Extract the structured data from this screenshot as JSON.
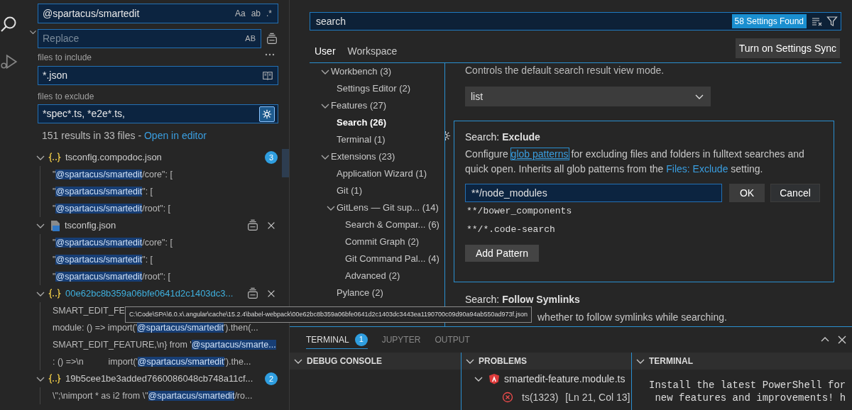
{
  "activity_bar": {
    "items": [
      {
        "kind": "search",
        "selected": true
      },
      {
        "kind": "run_debug",
        "selected": false
      }
    ]
  },
  "search_panel": {
    "replace_expanded": true,
    "query": "@spartacus/smartedit",
    "query_options": [
      "Aa",
      "ab",
      ".*"
    ],
    "replace_placeholder": "Replace",
    "replace_option": "AB",
    "include_label": "files to include",
    "include_value": "*.json",
    "exclude_label": "files to exclude",
    "exclude_value": "*spec*.ts, *e2e*.ts,",
    "use_exclude_settings": true,
    "summary": "151 results in 33 files - ",
    "open_in_editor": "Open in editor",
    "results": [
      {
        "name": "tsconfig.compodoc.json",
        "kind": "json",
        "focused": false,
        "expanded": true,
        "badge": "3",
        "matches": [
          {
            "before": "\"",
            "match": "@spartacus/smartedit",
            "after": "/core\": ["
          },
          {
            "before": "\"",
            "match": "@spartacus/smartedit",
            "after": "\": ["
          },
          {
            "before": "\"",
            "match": "@spartacus/smartedit",
            "after": "/root\": ["
          }
        ]
      },
      {
        "name": "tsconfig.json",
        "kind": "ts",
        "focused": false,
        "expanded": true,
        "matches": [
          {
            "before": "\"",
            "match": "@spartacus/smartedit",
            "after": "/core\": ["
          },
          {
            "before": "\"",
            "match": "@spartacus/smartedit",
            "after": "\": ["
          },
          {
            "before": "\"",
            "match": "@spartacus/smartedit",
            "after": "/root\": ["
          }
        ]
      },
      {
        "name": "00e62bc8b359a06bfe0641d2c1403dc3...",
        "kind": "json",
        "focused": true,
        "expanded": true,
        "matches": [
          {
            "before": "SMART_EDIT_FE"
          },
          {
            "before": "module: () => import('",
            "match": "@spartacus/smartedit",
            "after": "').then(..."
          },
          {
            "before": "SMART_EDIT_FEATURE,\\n} from '",
            "match": "@spartacus/smarte..."
          },
          {
            "before": ": () =>\\n          import('",
            "match": "@spartacus/smartedit",
            "after": "').the..."
          }
        ]
      },
      {
        "name": "19b5cee1be3added7660086048cb748a11cf...",
        "kind": "json",
        "focused": false,
        "expanded": true,
        "badge": "2",
        "matches": [
          {
            "before": "\\\";\\nimport * as i2 from \\\"",
            "match": "@spartacus/smartedit",
            "after": "/ro..."
          }
        ]
      }
    ]
  },
  "settings": {
    "search": "search",
    "found": "58 Settings Found",
    "tabs": [
      {
        "label": "User",
        "selected": true
      },
      {
        "label": "Workspace",
        "selected": false
      }
    ],
    "sync_button": "Turn on Settings Sync",
    "toc": [
      {
        "label": "Workbench (3)",
        "expanded": true,
        "selected": false,
        "children": [
          {
            "label": "Settings Editor (2)",
            "selected": false
          }
        ]
      },
      {
        "label": "Features (27)",
        "expanded": true,
        "selected": false,
        "children": [
          {
            "label": "Search (26)",
            "selected": true
          },
          {
            "label": "Terminal (1)",
            "selected": false
          }
        ]
      },
      {
        "label": "Extensions (23)",
        "expanded": true,
        "selected": false,
        "children": [
          {
            "label": "Application Wizard (1)",
            "selected": false
          },
          {
            "label": "Git (1)",
            "selected": false
          },
          {
            "label": "GitLens — Git sup... (14)",
            "expanded": true,
            "selected": false,
            "children": [
              {
                "label": "Search & Compar... (6)",
                "selected": false
              },
              {
                "label": "Commit Graph (2)",
                "selected": false
              },
              {
                "label": "Git Command Pal... (4)",
                "selected": false
              },
              {
                "label": "Advanced (2)",
                "selected": false
              }
            ]
          },
          {
            "label": "Pylance (2)",
            "selected": false
          }
        ]
      }
    ],
    "sections": [
      {
        "kind": "dropdown",
        "description": "Controls the default search result view mode.",
        "value": "list"
      },
      {
        "kind": "list_editor",
        "focused": true,
        "category": "Search: ",
        "title": "Exclude",
        "description": [
          {
            "text": "Configure "
          },
          {
            "text": "glob patterns",
            "kind": "link",
            "focused": true
          },
          {
            "text": " for excluding files and folders in fulltext searches and quick open. Inherits all glob patterns from the "
          },
          {
            "text": "Files: Exclude",
            "kind": "link",
            "focused": false
          },
          {
            "text": " setting."
          }
        ],
        "edit_value": "**/node_modules",
        "ok": "OK",
        "cancel": "Cancel",
        "patterns": [
          "**/bower_components",
          "**/*.code-search"
        ],
        "add": "Add Pattern"
      },
      {
        "kind": "text",
        "category": "Search: ",
        "title": "Follow Symlinks",
        "description": "whether to follow symlinks while searching."
      }
    ]
  },
  "panel": {
    "tabs": [
      {
        "label": "TERMINAL",
        "selected": true,
        "badge": "1"
      },
      {
        "label": "JUPYTER",
        "selected": false
      },
      {
        "label": "OUTPUT",
        "selected": false
      }
    ],
    "views": [
      {
        "kind": "debug",
        "title": "DEBUG CONSOLE",
        "expanded": true
      },
      {
        "kind": "problems",
        "title": "PROBLEMS",
        "expanded": true,
        "files": [
          {
            "name": "smartedit-feature.module.ts",
            "expanded": true,
            "problems": [
              {
                "code": "ts(1323)",
                "location": "[Ln 21, Col 13]"
              }
            ]
          }
        ]
      },
      {
        "kind": "terminal",
        "title": "TERMINAL",
        "expanded": true,
        "lines": [
          "Install the latest PowerShell for",
          " new features and improvements! h"
        ]
      }
    ]
  },
  "tooltip": {
    "text": "C:\\Code\\SPA\\6.0.x\\.angular\\cache\\15.2.4\\babel-webpack\\00e62bc8b359a06bfe0641d2c1403dc3443ea1190700c09d90a94ab550ad973f.json"
  }
}
